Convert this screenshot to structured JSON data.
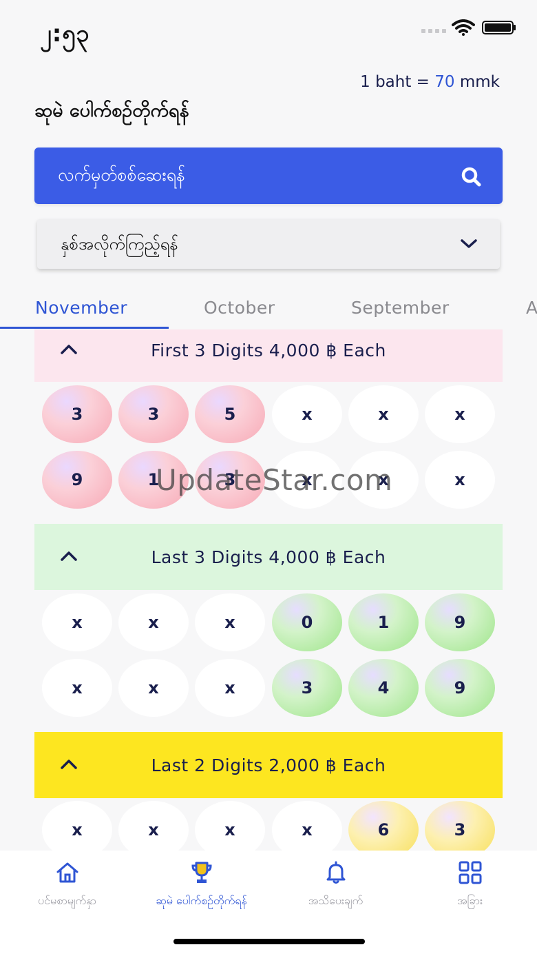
{
  "status_bar": {
    "time": "၂:၅၃"
  },
  "exchange_rate": {
    "prefix": "1 baht = ",
    "value": "70",
    "suffix": " mmk"
  },
  "page_title": "ဆုမဲ ပေါက်စဥ်တိုက်ရန်",
  "search": {
    "label": "လက်မှတ်စစ်ဆေးရန်",
    "icon": "search-icon"
  },
  "year_select": {
    "label": "နှစ်အလိုက်ကြည့်ရန်",
    "icon": "chevron-down-icon"
  },
  "tabs": [
    "November",
    "October",
    "September",
    "A"
  ],
  "active_tab": "November",
  "sections": [
    {
      "title": "First 3 Digits 4,000 ฿ Each",
      "color": "#fce6ee",
      "rows": [
        [
          "3",
          "3",
          "5",
          "x",
          "x",
          "x"
        ],
        [
          "9",
          "1",
          "3",
          "x",
          "x",
          "x"
        ]
      ]
    },
    {
      "title": "Last 3 Digits 4,000 ฿ Each",
      "color": "#dcf6dd",
      "rows": [
        [
          "x",
          "x",
          "x",
          "0",
          "1",
          "9"
        ],
        [
          "x",
          "x",
          "x",
          "3",
          "4",
          "9"
        ]
      ]
    },
    {
      "title": "Last 2 Digits 2,000 ฿ Each",
      "color": "#fde620",
      "rows": [
        [
          "x",
          "x",
          "x",
          "x",
          "6",
          "3"
        ]
      ]
    }
  ],
  "watermark": "UpdateStar.com",
  "bottom_nav": [
    {
      "label": "ပင်မစာမျက်နှာ",
      "icon": "home-icon"
    },
    {
      "label": "ဆုမဲ ပေါက်စဥ်တိုက်ရန်",
      "icon": "trophy-icon"
    },
    {
      "label": "အသိပေးချက်",
      "icon": "bell-icon"
    },
    {
      "label": "အခြား",
      "icon": "grid-icon"
    }
  ],
  "active_nav": 1,
  "colors": {
    "accent": "#3b5ce6",
    "text": "#1a1f4d",
    "pink": "#fce6ee",
    "green": "#dcf6dd",
    "yellow": "#fde620"
  }
}
